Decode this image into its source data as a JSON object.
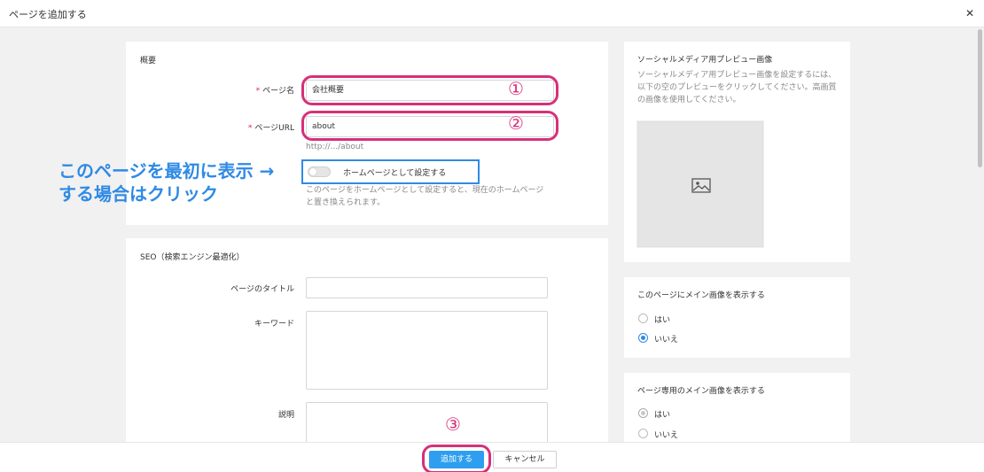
{
  "window": {
    "title": "ページを追加する",
    "close_glyph": "✕"
  },
  "overview": {
    "title": "概要",
    "page_name_label": "ページ名",
    "page_name_value": "会社概要",
    "page_url_label": "ページURL",
    "page_url_value": "about",
    "url_preview": "http://.../about",
    "homepage_toggle_label": "ホームページとして設定する",
    "homepage_hint": "このページをホームページとして設定すると、現在のホームページと置き換えられます。",
    "required_mark": "*"
  },
  "annotation": {
    "line1": "このページを最初に表示 →",
    "line2": "する場合はクリック",
    "num1": "①",
    "num2": "②",
    "num3": "③"
  },
  "seo": {
    "title": "SEO（検索エンジン最適化）",
    "page_title_label": "ページのタイトル",
    "page_title_value": "",
    "keywords_label": "キーワード",
    "keywords_value": "",
    "description_label": "説明",
    "description_value": ""
  },
  "social": {
    "title": "ソーシャルメディア用プレビュー画像",
    "description": "ソーシャルメディア用プレビュー画像を設定するには、以下の空のプレビューをクリックしてください。高画質の画像を使用してください。",
    "image_icon": "image-icon"
  },
  "main_image": {
    "title": "このページにメイン画像を表示する",
    "options": [
      {
        "label": "はい",
        "selected": false
      },
      {
        "label": "いいえ",
        "selected": true
      }
    ]
  },
  "page_main_image": {
    "title": "ページ専用のメイン画像を表示する",
    "options": [
      {
        "label": "はい",
        "selected": true
      },
      {
        "label": "いいえ",
        "selected": false
      }
    ]
  },
  "footer": {
    "add_label": "追加する",
    "cancel_label": "キャンセル"
  },
  "colors": {
    "accent": "#2e9ff0",
    "annotation_pink": "#d6307a",
    "annotation_blue": "#2f8ae5",
    "required": "#e0224f"
  }
}
